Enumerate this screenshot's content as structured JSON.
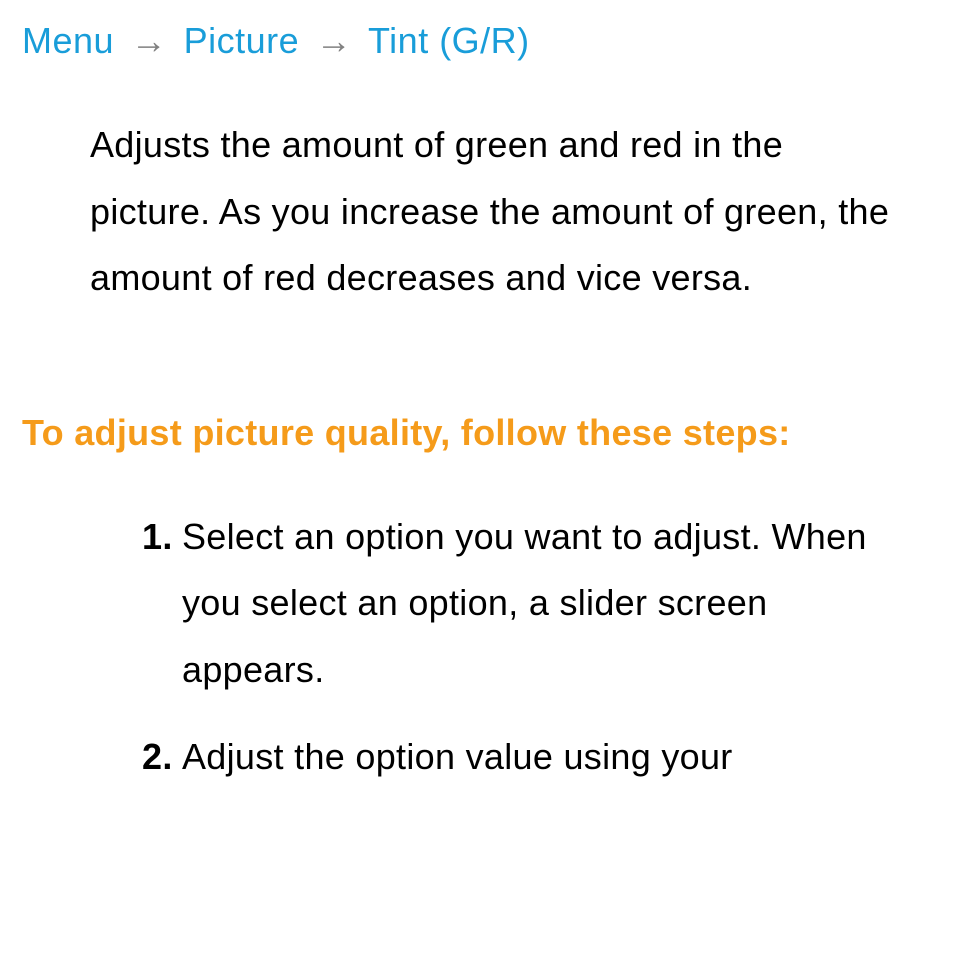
{
  "breadcrumb": {
    "items": [
      "Menu",
      "Picture",
      "Tint (G/R)"
    ],
    "separator": "→"
  },
  "description": "Adjusts the amount of green and red in the picture. As you increase the amount of green, the amount of red decreases and vice versa.",
  "sectionHeading": "To adjust picture quality, follow these steps:",
  "steps": [
    {
      "number": "1.",
      "text": "Select an option you want to adjust. When you select an option, a slider screen appears."
    },
    {
      "number": "2.",
      "text": "Adjust the option value using your"
    }
  ]
}
